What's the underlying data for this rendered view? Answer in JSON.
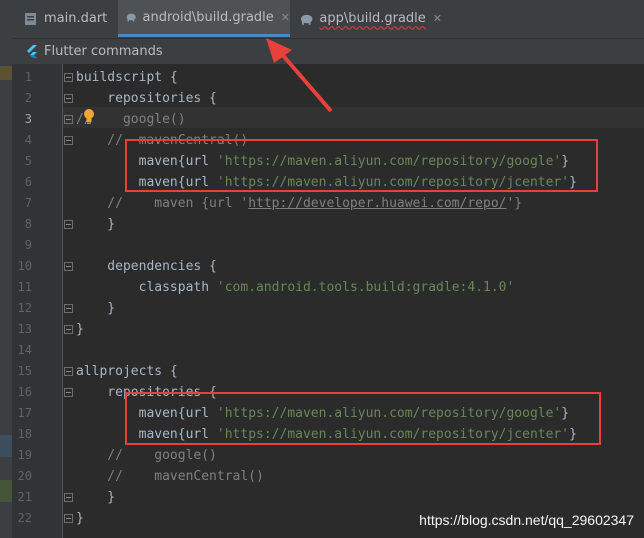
{
  "tabs": [
    {
      "label": "main.dart",
      "icon": "dart-file-icon",
      "active": false
    },
    {
      "label": "android\\build.gradle",
      "icon": "gradle-elephant-icon",
      "active": true
    },
    {
      "label": "app\\build.gradle",
      "icon": "gradle-elephant-icon",
      "active": false
    }
  ],
  "flutter_bar": {
    "label": "Flutter commands",
    "icon": "flutter-icon"
  },
  "editor": {
    "current_line": 3,
    "lines": [
      {
        "n": "1",
        "tokens": [
          {
            "t": "buildscript {",
            "c": "plain"
          }
        ]
      },
      {
        "n": "2",
        "tokens": [
          {
            "t": "    repositories {",
            "c": "plain"
          }
        ]
      },
      {
        "n": "3",
        "tokens": [
          {
            "t": "//    google()",
            "c": "cmt"
          }
        ]
      },
      {
        "n": "4",
        "tokens": [
          {
            "t": "    //  mavenCentral()",
            "c": "cmt"
          }
        ]
      },
      {
        "n": "5",
        "tokens": [
          {
            "t": "        maven{url ",
            "c": "plain"
          },
          {
            "t": "'https://maven.aliyun.com/repository/google'",
            "c": "str"
          },
          {
            "t": "}",
            "c": "plain"
          }
        ]
      },
      {
        "n": "6",
        "tokens": [
          {
            "t": "        maven{url ",
            "c": "plain"
          },
          {
            "t": "'https://maven.aliyun.com/repository/jcenter'",
            "c": "str"
          },
          {
            "t": "}",
            "c": "plain"
          }
        ]
      },
      {
        "n": "7",
        "tokens": [
          {
            "t": "    //    maven {url '",
            "c": "cmt"
          },
          {
            "t": "http://developer.huawei.com/repo/",
            "c": "lnk"
          },
          {
            "t": "'}",
            "c": "cmt"
          }
        ]
      },
      {
        "n": "8",
        "tokens": [
          {
            "t": "    }",
            "c": "plain"
          }
        ]
      },
      {
        "n": "9",
        "tokens": []
      },
      {
        "n": "10",
        "tokens": [
          {
            "t": "    dependencies {",
            "c": "plain"
          }
        ]
      },
      {
        "n": "11",
        "tokens": [
          {
            "t": "        classpath ",
            "c": "plain"
          },
          {
            "t": "'com.android.tools.build:gradle:4.1.0'",
            "c": "str"
          }
        ]
      },
      {
        "n": "12",
        "tokens": [
          {
            "t": "    }",
            "c": "plain"
          }
        ]
      },
      {
        "n": "13",
        "tokens": [
          {
            "t": "}",
            "c": "plain"
          }
        ]
      },
      {
        "n": "14",
        "tokens": []
      },
      {
        "n": "15",
        "tokens": [
          {
            "t": "allprojects {",
            "c": "plain"
          }
        ]
      },
      {
        "n": "16",
        "tokens": [
          {
            "t": "    repositories {",
            "c": "plain"
          }
        ]
      },
      {
        "n": "17",
        "tokens": [
          {
            "t": "        maven{url ",
            "c": "plain"
          },
          {
            "t": "'https://maven.aliyun.com/repository/google'",
            "c": "str"
          },
          {
            "t": "}",
            "c": "plain"
          }
        ]
      },
      {
        "n": "18",
        "tokens": [
          {
            "t": "        maven{url ",
            "c": "plain"
          },
          {
            "t": "'https://maven.aliyun.com/repository/jcenter'",
            "c": "str"
          },
          {
            "t": "}",
            "c": "plain"
          }
        ]
      },
      {
        "n": "19",
        "tokens": [
          {
            "t": "    //    google()",
            "c": "cmt"
          }
        ]
      },
      {
        "n": "20",
        "tokens": [
          {
            "t": "    //    mavenCentral()",
            "c": "cmt"
          }
        ]
      },
      {
        "n": "21",
        "tokens": [
          {
            "t": "    }",
            "c": "plain"
          }
        ]
      },
      {
        "n": "22",
        "tokens": [
          {
            "t": "}",
            "c": "plain"
          }
        ]
      }
    ]
  },
  "annotation": {
    "color": "#e8413b"
  },
  "watermark": "https://blog.csdn.net/qq_29602347",
  "colors": {
    "accent": "#4a88c7",
    "string": "#6a8759",
    "comment": "#808080",
    "text": "#a9b7c6"
  }
}
